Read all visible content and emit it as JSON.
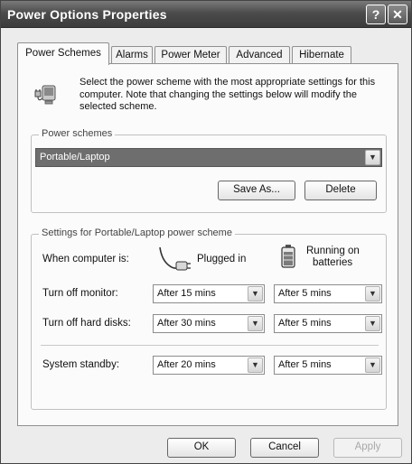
{
  "window": {
    "title": "Power Options Properties",
    "help_button": "?",
    "close_button": "✕"
  },
  "tabs": [
    {
      "label": "Power Schemes",
      "active": true
    },
    {
      "label": "Alarms",
      "active": false
    },
    {
      "label": "Power Meter",
      "active": false
    },
    {
      "label": "Advanced",
      "active": false
    },
    {
      "label": "Hibernate",
      "active": false
    }
  ],
  "intro": {
    "text": "Select the power scheme with the most appropriate settings for this computer. Note that changing the settings below will modify the selected scheme.",
    "icon": "power-options-icon"
  },
  "schemes": {
    "legend": "Power schemes",
    "selected": "Portable/Laptop",
    "save_as_label": "Save As...",
    "delete_label": "Delete"
  },
  "settings": {
    "legend": "Settings for Portable/Laptop power scheme",
    "when_label": "When computer is:",
    "plugged_label": "Plugged in",
    "battery_label_line1": "Running on",
    "battery_label_line2": "batteries",
    "rows": [
      {
        "label": "Turn off monitor:",
        "plugged": "After 15 mins",
        "battery": "After 5 mins"
      },
      {
        "label": "Turn off hard disks:",
        "plugged": "After 30 mins",
        "battery": "After 5 mins"
      },
      {
        "label": "System standby:",
        "plugged": "After 20 mins",
        "battery": "After 5 mins"
      }
    ]
  },
  "footer": {
    "ok_label": "OK",
    "cancel_label": "Cancel",
    "apply_label": "Apply"
  }
}
